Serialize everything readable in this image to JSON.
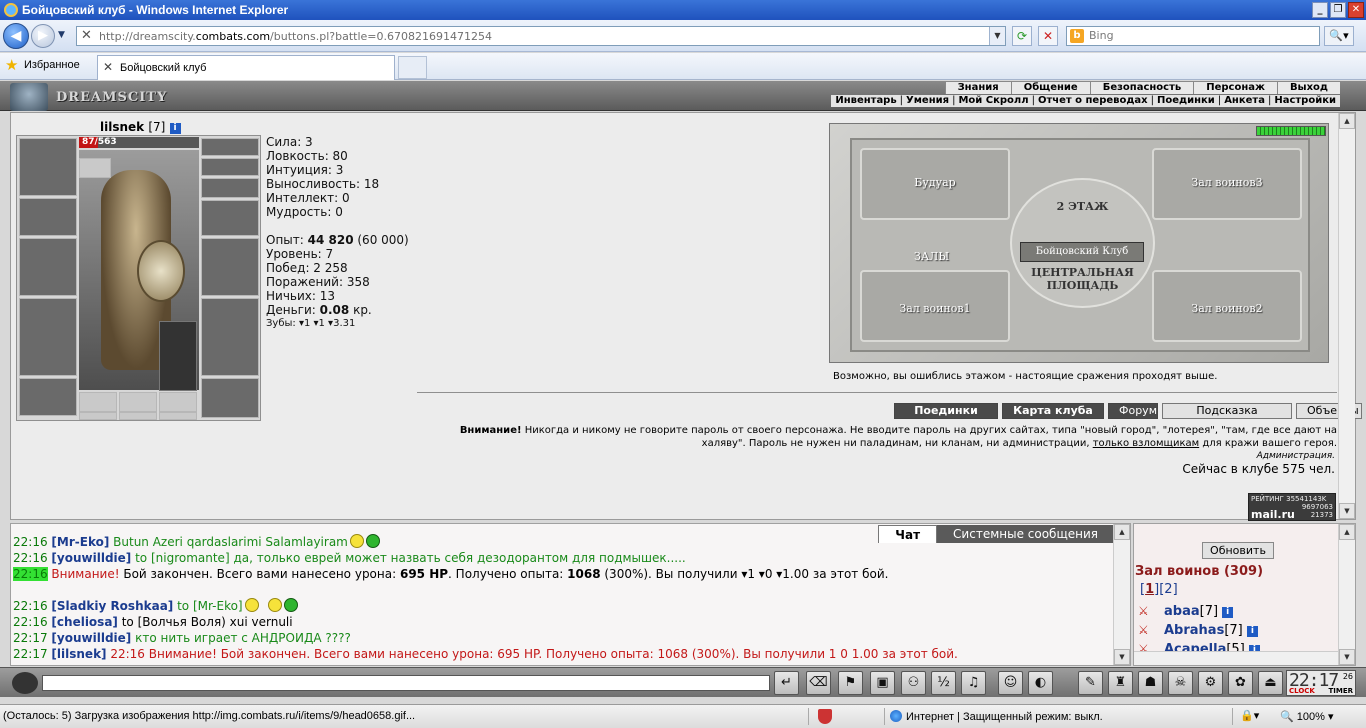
{
  "window": {
    "title": "Бойцовский клуб - Windows Internet Explorer"
  },
  "address_bar": {
    "url_prefix": "http://dreamscity.",
    "url_domain": "combats.com",
    "url_suffix": "/buttons.pl?battle=0.670821691471254",
    "search_placeholder": "Bing"
  },
  "favorites_bar": {
    "favorites_label": "Избранное",
    "tab_title": "Бойцовский клуб"
  },
  "game_header": {
    "logo": "DREAMSCITY",
    "top_menu": [
      "Знания",
      "Общение",
      "Безопасность",
      "Персонаж",
      "Выход"
    ],
    "sub_menu": [
      "Инвентарь",
      "Умения",
      "Мой Скролл",
      "Отчет о переводах",
      "Поединки",
      "Анкета",
      "Настройки"
    ]
  },
  "character": {
    "name": "lilsnek",
    "level": "[7]",
    "hp_current": "87",
    "hp_max": "563",
    "hp_fraction": 0.155,
    "stats": [
      "Сила: 3",
      "Ловкость: 80",
      "Интуиция: 3",
      "Выносливость: 18",
      "Интеллект: 0",
      "Мудрость: 0"
    ],
    "experience_label": "Опыт: ",
    "experience_value": "44 820",
    "experience_next": " (60 000)",
    "level_line": "Уровень: 7",
    "wins_line": "Побед: 2 258",
    "losses_line": "Поражений: 358",
    "draws_line": "Ничьих: 13",
    "money_label": "Деньги: ",
    "money_value": "0.08",
    "money_unit": " кр.",
    "teeth_line": "Зубы: ▾1 ▾1 ▾3.31"
  },
  "map": {
    "rooms": {
      "boudoir": "Будуар",
      "hall3": "Зал воинов3",
      "floor2": "2 ЭТАЖ",
      "club": "Бойцовский Клуб",
      "halls": "ЗАЛЫ",
      "central": "ЦЕНТРАЛЬНАЯ ПЛОЩАДЬ",
      "hall1": "Зал воинов1",
      "hall2": "Зал воинов2"
    },
    "note": "Возможно, вы ошиблись этажом - настоящие сражения проходят выше."
  },
  "buttons": {
    "duels": "Поединки",
    "club_map": "Карта клуба",
    "forum": "Форум",
    "hint": "Подсказка",
    "objects": "Объекты"
  },
  "warning": {
    "bold": "Внимание!",
    "text1": " Никогда и никому не говорите пароль от своего персонажа. Не вводите пароль на других сайтах, типа \"новый город\", \"лотерея\", \"там, где все дают на халяву\". Пароль не нужен ни паладинам, ни кланам, ни администрации, ",
    "link": "только взломщикам",
    "text2": " для кражи вашего героя.",
    "admin": "Администрация.",
    "online_now": "Сейчас в клубе 575 чел."
  },
  "rating_badge": {
    "line1": "РЕЙТИНГ 35541143K",
    "line2": "9697063",
    "line3": "21373",
    "brand": "mail.ru"
  },
  "chat": {
    "tabs": [
      "Чат",
      "Системные сообщения"
    ],
    "messages": [
      {
        "time": "22:16",
        "nick": "[Mr-Eko]",
        "text": " Butun Azeri qardaslarimi Salamlayiram"
      },
      {
        "time": "22:16",
        "nick": "[youwilldie]",
        "text": " to [nigromante] да, только еврей может назвать себя дезодорантом для подмышек....."
      },
      {
        "time": "22:16",
        "alert": "Внимание!",
        "text_a": " Бой закончен. Всего вами нанесено урона: ",
        "dmg": "695 HP",
        "text_b": ". Получено опыта: ",
        "exp": "1068",
        "text_c": " (300%). Вы получили ▾1 ▾0 ▾1.00 за этот бой."
      },
      {
        "time": "22:16",
        "nick": "[Sladkiy Roshkaa]",
        "text": " to [Mr-Eko]"
      },
      {
        "time": "22:16",
        "nick": "[cheliosa]",
        "text": " to [Волчья Воля) xui vernuli"
      },
      {
        "time": "22:17",
        "nick": "[youwilldie]",
        "text": " кто нить играет с АНДРОИДА ????"
      },
      {
        "time": "22:17",
        "nick": "[lilsnek]",
        "text": " 22:16 Внимание! Бой закончен. Всего вами нанесено урона: 695 HP. Получено опыта: 1068 (300%). Вы получили 1 0 1.00 за этот бой."
      }
    ]
  },
  "online_list": {
    "refresh": "Обновить",
    "room": "Зал воинов (309)",
    "page_current": "1",
    "page_other": "2",
    "players": [
      {
        "name": "abaa",
        "level": "[7]"
      },
      {
        "name": "Abrahas",
        "level": "[7]"
      },
      {
        "name": "Acapella",
        "level": "[5]"
      }
    ]
  },
  "clock": {
    "time": "22:17",
    "seconds": "26",
    "label_clock": "CLOCK",
    "label_timer": "TIMER"
  },
  "status_bar": {
    "message": "(Осталось: 5) Загрузка изображения http://img.combats.ru/i/items/9/head0658.gif...",
    "zone": "Интернет | Защищенный режим: выкл.",
    "zoom": "100%"
  },
  "colors": {
    "ie_title": "#1f52bd",
    "chat_time": "#0a7a0a",
    "chat_nick": "#1b3c8f",
    "alert": "#c31818",
    "hp_bar": "#c21515"
  }
}
